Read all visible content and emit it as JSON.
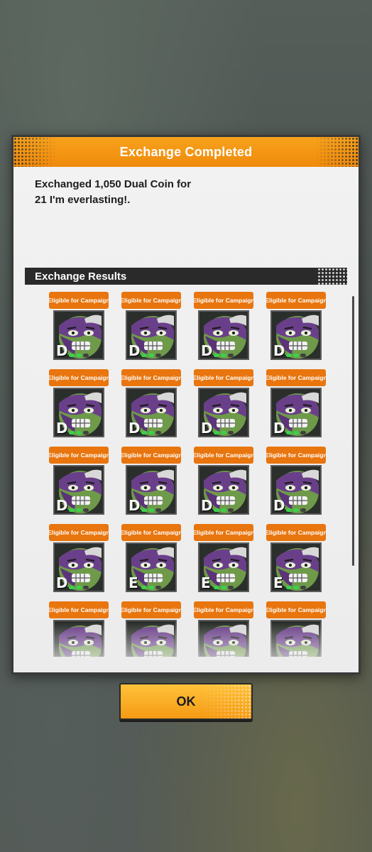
{
  "dialog": {
    "title": "Exchange Completed",
    "message_line1": "Exchanged 1,050 Dual Coin for",
    "message_line2": "21 I'm everlasting!.",
    "results_header": "Exchange Results"
  },
  "items": [
    {
      "badge": "Eligible for Campaign",
      "rank": "D",
      "dots_lit": 2
    },
    {
      "badge": "Eligible for Campaign",
      "rank": "D",
      "dots_lit": 2
    },
    {
      "badge": "Eligible for Campaign",
      "rank": "D",
      "dots_lit": 2
    },
    {
      "badge": "Eligible for Campaign",
      "rank": "D",
      "dots_lit": 2
    },
    {
      "badge": "Eligible for Campaign",
      "rank": "D",
      "dots_lit": 2
    },
    {
      "badge": "Eligible for Campaign",
      "rank": "D",
      "dots_lit": 2
    },
    {
      "badge": "Eligible for Campaign",
      "rank": "D",
      "dots_lit": 2
    },
    {
      "badge": "Eligible for Campaign",
      "rank": "D",
      "dots_lit": 2
    },
    {
      "badge": "Eligible for Campaign",
      "rank": "D",
      "dots_lit": 2
    },
    {
      "badge": "Eligible for Campaign",
      "rank": "D",
      "dots_lit": 2
    },
    {
      "badge": "Eligible for Campaign",
      "rank": "D",
      "dots_lit": 2
    },
    {
      "badge": "Eligible for Campaign",
      "rank": "D",
      "dots_lit": 2
    },
    {
      "badge": "Eligible for Campaign",
      "rank": "D",
      "dots_lit": 2
    },
    {
      "badge": "Eligible for Campaign",
      "rank": "E",
      "dots_lit": 2
    },
    {
      "badge": "Eligible for Campaign",
      "rank": "E",
      "dots_lit": 2
    },
    {
      "badge": "Eligible for Campaign",
      "rank": "E",
      "dots_lit": 2
    },
    {
      "badge": "Eligible for Campaign",
      "rank": "",
      "dots_lit": 0
    },
    {
      "badge": "Eligible for Campaign",
      "rank": "",
      "dots_lit": 0
    },
    {
      "badge": "Eligible for Campaign",
      "rank": "",
      "dots_lit": 0
    },
    {
      "badge": "Eligible for Campaign",
      "rank": "",
      "dots_lit": 0
    }
  ],
  "ok_button": {
    "label": "OK"
  },
  "colors": {
    "accent_orange": "#f08a0c",
    "badge_orange": "#e8750e",
    "indicator_green": "#3bd14a"
  },
  "icons": {
    "portrait": "green-purple-face-portrait-icon"
  }
}
